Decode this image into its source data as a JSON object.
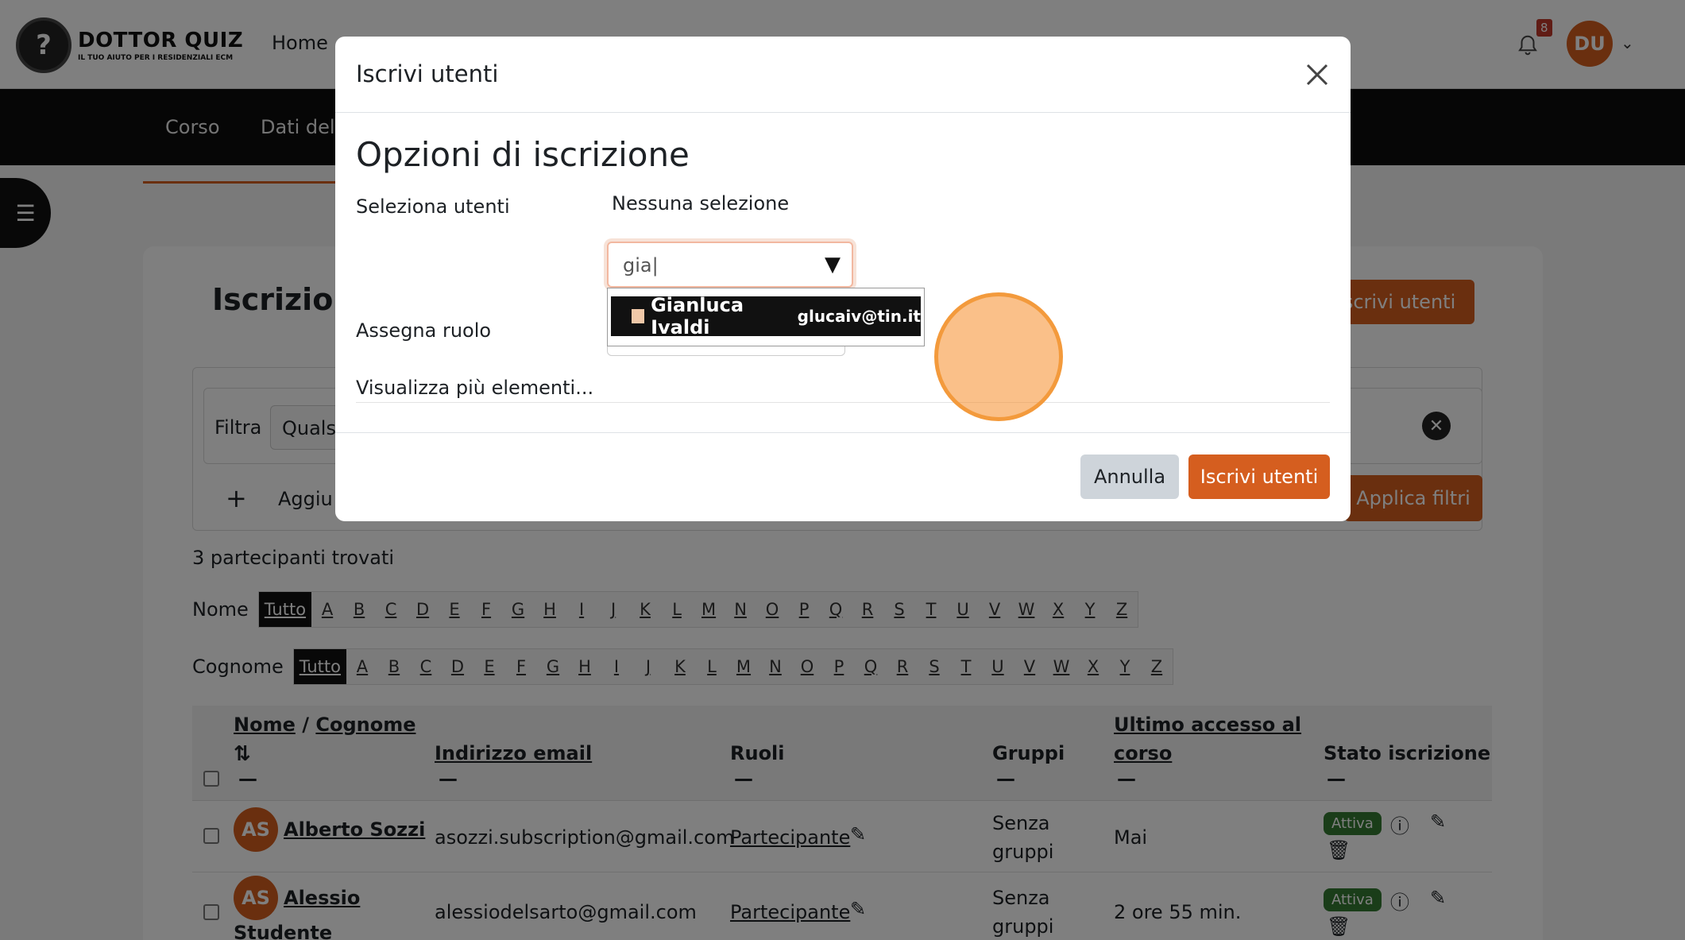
{
  "header": {
    "logo_title": "DOTTOR QUIZ",
    "logo_subtitle": "IL TUO AIUTO PER I RESIDENZIALI ECM",
    "nav_home": "Home",
    "notification_count": "8",
    "user_initials": "DU"
  },
  "secondary_nav": {
    "items": [
      "Corso",
      "Dati del"
    ]
  },
  "page": {
    "title": "Iscrizioni",
    "enrol_button": "Iscrivi utenti",
    "filter_label": "Filtra",
    "filter_value": "Quals",
    "add_condition": "Aggiu",
    "apply_filters": "Applica filtri",
    "found_text": "3 partecipanti trovati",
    "first_name_label": "Nome",
    "last_name_label": "Cognome",
    "letters": [
      "Tutto",
      "A",
      "B",
      "C",
      "D",
      "E",
      "F",
      "G",
      "H",
      "I",
      "J",
      "K",
      "L",
      "M",
      "N",
      "O",
      "P",
      "Q",
      "R",
      "S",
      "T",
      "U",
      "V",
      "W",
      "X",
      "Y",
      "Z"
    ]
  },
  "table": {
    "headers": {
      "first_name": "Nome",
      "separator": "/",
      "last_name": "Cognome",
      "email": "Indirizzo email",
      "roles": "Ruoli",
      "groups": "Gruppi",
      "last_access_1": "Ultimo accesso al",
      "last_access_2": "corso",
      "status": "Stato iscrizione",
      "dash": "—"
    },
    "rows": [
      {
        "initials": "AS",
        "name": "Alberto Sozzi",
        "name2": "",
        "email": "asozzi.subscription@gmail.com",
        "role": "Partecipante",
        "groups_1": "Senza",
        "groups_2": "gruppi",
        "last_access": "Mai",
        "status": "Attiva"
      },
      {
        "initials": "AS",
        "name": "Alessio",
        "name2": "Studente",
        "email": "alessiodelsarto@gmail.com",
        "role": "Partecipante",
        "groups_1": "Senza",
        "groups_2": "gruppi",
        "last_access": "2 ore 55 min.",
        "status": "Attiva"
      }
    ]
  },
  "modal": {
    "title": "Iscrivi utenti",
    "section_title": "Opzioni di iscrizione",
    "select_users_label": "Seleziona utenti",
    "no_selection": "Nessuna selezione",
    "search_value": "gia|",
    "assign_role_label": "Assegna ruolo",
    "dropdown_option_name": "Gianluca Ivaldi",
    "dropdown_option_email": "glucaiv@tin.it",
    "show_more": "Visualizza più elementi...",
    "cancel_button": "Annulla",
    "submit_button": "Iscrivi utenti"
  },
  "colors": {
    "accent": "#d55e1f",
    "dark": "#0d0d0d",
    "success": "#357a32",
    "click_indicator": "#f39a3c"
  }
}
